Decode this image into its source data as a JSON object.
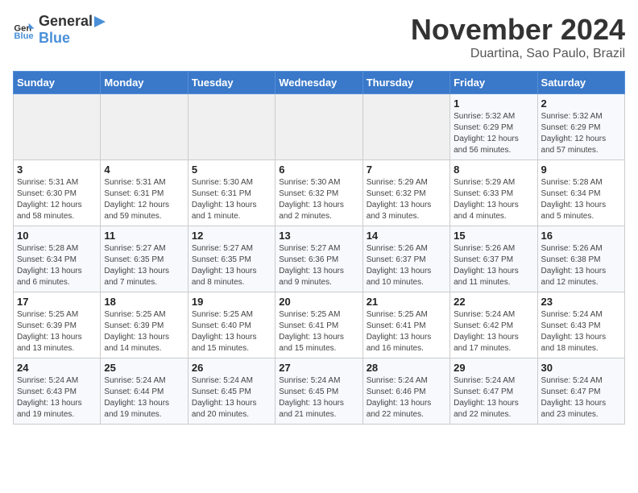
{
  "header": {
    "logo_general": "General",
    "logo_blue": "Blue",
    "month_title": "November 2024",
    "location": "Duartina, Sao Paulo, Brazil"
  },
  "days_of_week": [
    "Sunday",
    "Monday",
    "Tuesday",
    "Wednesday",
    "Thursday",
    "Friday",
    "Saturday"
  ],
  "weeks": [
    [
      {
        "day": "",
        "info": ""
      },
      {
        "day": "",
        "info": ""
      },
      {
        "day": "",
        "info": ""
      },
      {
        "day": "",
        "info": ""
      },
      {
        "day": "",
        "info": ""
      },
      {
        "day": "1",
        "info": "Sunrise: 5:32 AM\nSunset: 6:29 PM\nDaylight: 12 hours and 56 minutes."
      },
      {
        "day": "2",
        "info": "Sunrise: 5:32 AM\nSunset: 6:29 PM\nDaylight: 12 hours and 57 minutes."
      }
    ],
    [
      {
        "day": "3",
        "info": "Sunrise: 5:31 AM\nSunset: 6:30 PM\nDaylight: 12 hours and 58 minutes."
      },
      {
        "day": "4",
        "info": "Sunrise: 5:31 AM\nSunset: 6:31 PM\nDaylight: 12 hours and 59 minutes."
      },
      {
        "day": "5",
        "info": "Sunrise: 5:30 AM\nSunset: 6:31 PM\nDaylight: 13 hours and 1 minute."
      },
      {
        "day": "6",
        "info": "Sunrise: 5:30 AM\nSunset: 6:32 PM\nDaylight: 13 hours and 2 minutes."
      },
      {
        "day": "7",
        "info": "Sunrise: 5:29 AM\nSunset: 6:32 PM\nDaylight: 13 hours and 3 minutes."
      },
      {
        "day": "8",
        "info": "Sunrise: 5:29 AM\nSunset: 6:33 PM\nDaylight: 13 hours and 4 minutes."
      },
      {
        "day": "9",
        "info": "Sunrise: 5:28 AM\nSunset: 6:34 PM\nDaylight: 13 hours and 5 minutes."
      }
    ],
    [
      {
        "day": "10",
        "info": "Sunrise: 5:28 AM\nSunset: 6:34 PM\nDaylight: 13 hours and 6 minutes."
      },
      {
        "day": "11",
        "info": "Sunrise: 5:27 AM\nSunset: 6:35 PM\nDaylight: 13 hours and 7 minutes."
      },
      {
        "day": "12",
        "info": "Sunrise: 5:27 AM\nSunset: 6:35 PM\nDaylight: 13 hours and 8 minutes."
      },
      {
        "day": "13",
        "info": "Sunrise: 5:27 AM\nSunset: 6:36 PM\nDaylight: 13 hours and 9 minutes."
      },
      {
        "day": "14",
        "info": "Sunrise: 5:26 AM\nSunset: 6:37 PM\nDaylight: 13 hours and 10 minutes."
      },
      {
        "day": "15",
        "info": "Sunrise: 5:26 AM\nSunset: 6:37 PM\nDaylight: 13 hours and 11 minutes."
      },
      {
        "day": "16",
        "info": "Sunrise: 5:26 AM\nSunset: 6:38 PM\nDaylight: 13 hours and 12 minutes."
      }
    ],
    [
      {
        "day": "17",
        "info": "Sunrise: 5:25 AM\nSunset: 6:39 PM\nDaylight: 13 hours and 13 minutes."
      },
      {
        "day": "18",
        "info": "Sunrise: 5:25 AM\nSunset: 6:39 PM\nDaylight: 13 hours and 14 minutes."
      },
      {
        "day": "19",
        "info": "Sunrise: 5:25 AM\nSunset: 6:40 PM\nDaylight: 13 hours and 15 minutes."
      },
      {
        "day": "20",
        "info": "Sunrise: 5:25 AM\nSunset: 6:41 PM\nDaylight: 13 hours and 15 minutes."
      },
      {
        "day": "21",
        "info": "Sunrise: 5:25 AM\nSunset: 6:41 PM\nDaylight: 13 hours and 16 minutes."
      },
      {
        "day": "22",
        "info": "Sunrise: 5:24 AM\nSunset: 6:42 PM\nDaylight: 13 hours and 17 minutes."
      },
      {
        "day": "23",
        "info": "Sunrise: 5:24 AM\nSunset: 6:43 PM\nDaylight: 13 hours and 18 minutes."
      }
    ],
    [
      {
        "day": "24",
        "info": "Sunrise: 5:24 AM\nSunset: 6:43 PM\nDaylight: 13 hours and 19 minutes."
      },
      {
        "day": "25",
        "info": "Sunrise: 5:24 AM\nSunset: 6:44 PM\nDaylight: 13 hours and 19 minutes."
      },
      {
        "day": "26",
        "info": "Sunrise: 5:24 AM\nSunset: 6:45 PM\nDaylight: 13 hours and 20 minutes."
      },
      {
        "day": "27",
        "info": "Sunrise: 5:24 AM\nSunset: 6:45 PM\nDaylight: 13 hours and 21 minutes."
      },
      {
        "day": "28",
        "info": "Sunrise: 5:24 AM\nSunset: 6:46 PM\nDaylight: 13 hours and 22 minutes."
      },
      {
        "day": "29",
        "info": "Sunrise: 5:24 AM\nSunset: 6:47 PM\nDaylight: 13 hours and 22 minutes."
      },
      {
        "day": "30",
        "info": "Sunrise: 5:24 AM\nSunset: 6:47 PM\nDaylight: 13 hours and 23 minutes."
      }
    ]
  ]
}
